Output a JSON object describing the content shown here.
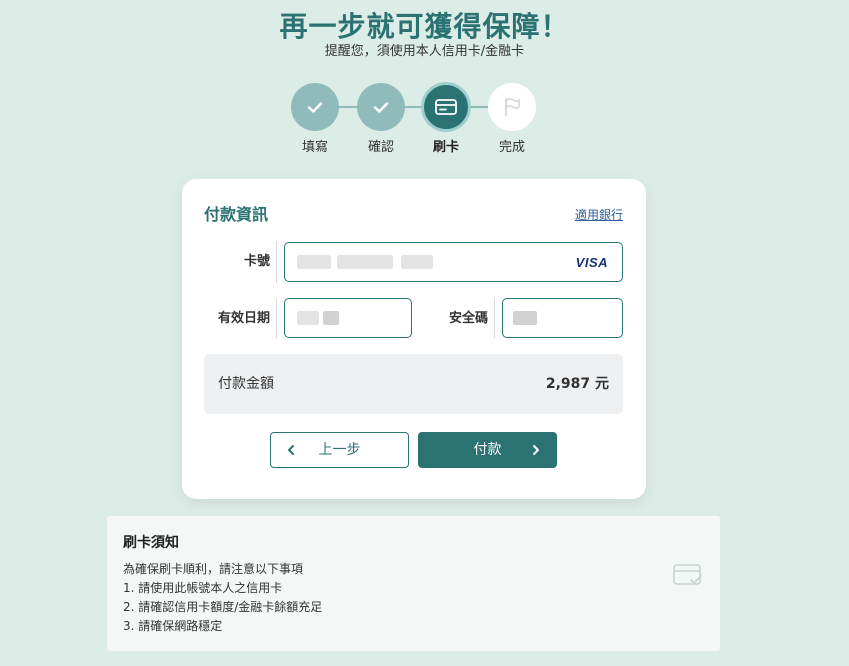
{
  "header": {
    "title": "再一步就可獲得保障！",
    "subtitle": "提醒您，須使用本人信用卡/金融卡"
  },
  "stepper": {
    "steps": [
      {
        "label": "填寫",
        "state": "done",
        "icon": "check-icon"
      },
      {
        "label": "確認",
        "state": "done",
        "icon": "check-icon"
      },
      {
        "label": "刷卡",
        "state": "current",
        "icon": "credit-card-icon"
      },
      {
        "label": "完成",
        "state": "todo",
        "icon": "flag-icon"
      }
    ]
  },
  "payment": {
    "title": "付款資訊",
    "bank_link": "適用銀行",
    "card_number_label": "卡號",
    "card_brand": "VISA",
    "expiry_label": "有效日期",
    "cvv_label": "安全碼",
    "amount_label": "付款金額",
    "amount_value": "2,987 元",
    "back_label": "上一步",
    "pay_label": "付款"
  },
  "notice": {
    "title": "刷卡須知",
    "intro": "為確保刷卡順利，請注意以下事項",
    "items": [
      "1. 請使用此帳號本人之信用卡",
      "2. 請確認信用卡額度/金融卡餘額充足",
      "3. 請確保網路穩定"
    ],
    "icon": "card-check-icon"
  },
  "colors": {
    "background": "#dcece7",
    "accent": "#2b7272",
    "step_done": "#8fbcbb",
    "link": "#2b5c9a"
  }
}
